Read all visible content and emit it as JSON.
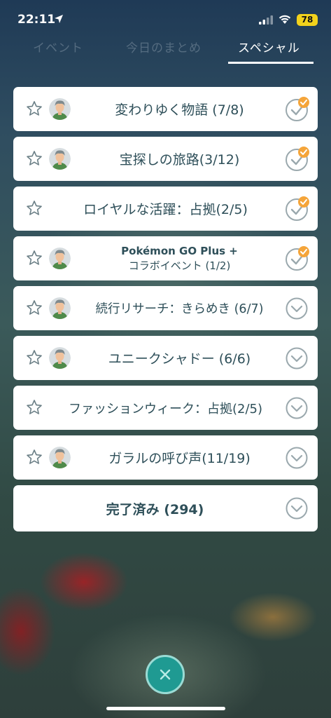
{
  "status_bar": {
    "time": "22:11",
    "battery": "78"
  },
  "tabs": [
    {
      "label": "イベント",
      "active": false
    },
    {
      "label": "今日のまとめ",
      "active": false
    },
    {
      "label": "スペシャル",
      "active": true
    }
  ],
  "research_items": [
    {
      "title": "変わりゆく物語 (7/8)",
      "status": "claimable"
    },
    {
      "title": "宝探しの旅路(3/12)",
      "status": "claimable"
    },
    {
      "title": "ロイヤルな活躍：占拠(2/5)",
      "status": "claimable"
    },
    {
      "title_line1": "Pokémon GO Plus +",
      "title_line2": "コラボイベント (1/2)",
      "status": "claimable"
    },
    {
      "title": "続行リサーチ：きらめき (6/7)",
      "status": "collapsed"
    },
    {
      "title": "ユニークシャドー (6/6)",
      "status": "collapsed"
    },
    {
      "title": "ファッションウィーク：占拠(2/5)",
      "status": "collapsed"
    },
    {
      "title": "ガラルの呼び声(11/19)",
      "status": "collapsed"
    }
  ],
  "completed": {
    "title": "完了済み (294)"
  },
  "colors": {
    "accent_check": "#f5a53a",
    "text": "#2e4f59",
    "close_button": "#1f9a92"
  },
  "icons": {
    "favorite": "star-icon",
    "expand": "chevron-down-icon",
    "claim": "check-icon",
    "close": "close-icon"
  }
}
